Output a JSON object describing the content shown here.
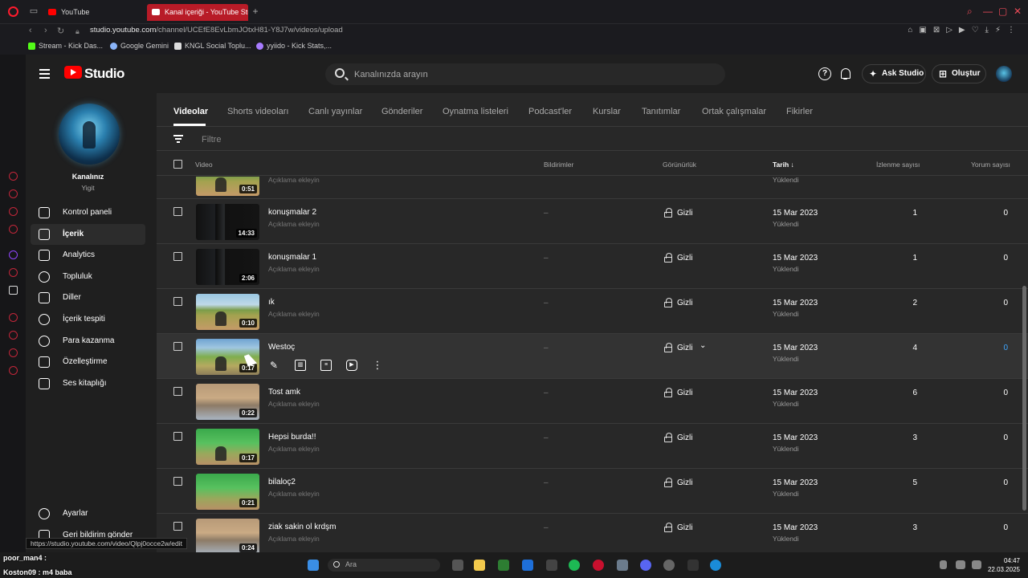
{
  "browser": {
    "tabs": [
      {
        "label": "YouTube",
        "active": false
      },
      {
        "label": "Kanal içeriği - YouTube Stu",
        "active": true
      }
    ],
    "url_host": "studio.youtube.com",
    "url_path": "/channel/UCEfE8EvLbmJOtxH81-Y8J7w/videos/upload",
    "bookmarks": [
      "Stream - Kick Das...",
      "Google Gemini",
      "KNGL Social Toplu...",
      "yyiido - Kick Stats,..."
    ]
  },
  "header": {
    "logo_text": "Studio",
    "search_placeholder": "Kanalınızda arayın",
    "ask_studio": "Ask Studio",
    "create": "Oluştur"
  },
  "channel": {
    "title": "Kanalınız",
    "name": "Yigit"
  },
  "nav": [
    {
      "label": "Kontrol paneli",
      "icon": "dashboard-icon"
    },
    {
      "label": "İçerik",
      "icon": "content-icon",
      "active": true
    },
    {
      "label": "Analytics",
      "icon": "analytics-icon"
    },
    {
      "label": "Topluluk",
      "icon": "community-icon"
    },
    {
      "label": "Diller",
      "icon": "subtitles-icon"
    },
    {
      "label": "İçerik tespiti",
      "icon": "copyright-icon"
    },
    {
      "label": "Para kazanma",
      "icon": "monetization-icon"
    },
    {
      "label": "Özelleştirme",
      "icon": "customization-icon"
    },
    {
      "label": "Ses kitaplığı",
      "icon": "audio-library-icon"
    }
  ],
  "nav_bottom": {
    "settings": "Ayarlar",
    "feedback": "Geri bildirim gönder"
  },
  "content_tabs": [
    "Videolar",
    "Shorts videoları",
    "Canlı yayınlar",
    "Gönderiler",
    "Oynatma listeleri",
    "Podcast'ler",
    "Kurslar",
    "Tanıtımlar",
    "Ortak çalışmalar",
    "Fikirler"
  ],
  "filter_placeholder": "Filtre",
  "columns": {
    "video": "Video",
    "notifications": "Bildirimler",
    "visibility": "Görünürlük",
    "date": "Tarih",
    "views": "İzlenme sayısı",
    "comments": "Yorum sayısı"
  },
  "desc_placeholder": "Açıklama ekleyin",
  "partial_row": {
    "duration": "0:51"
  },
  "rows": [
    {
      "title": "konuşmalar 2",
      "duration": "14:33",
      "notifications": "–",
      "visibility": "Gizli",
      "date": "15 Mar 2023",
      "status": "Yüklendi",
      "views": "1",
      "comments": "0"
    },
    {
      "title": "konuşmalar 1",
      "duration": "2:06",
      "notifications": "–",
      "visibility": "Gizli",
      "date": "15 Mar 2023",
      "status": "Yüklendi",
      "views": "1",
      "comments": "0"
    },
    {
      "title": "ık",
      "duration": "0:10",
      "notifications": "–",
      "visibility": "Gizli",
      "date": "15 Mar 2023",
      "status": "Yüklendi",
      "views": "2",
      "comments": "0"
    },
    {
      "title": "Westoç",
      "duration": "0:17",
      "notifications": "–",
      "visibility": "Gizli",
      "date": "15 Mar 2023",
      "status": "Yüklendi",
      "views": "4",
      "comments": "0",
      "hover": true
    },
    {
      "title": "Tost amk",
      "duration": "0:22",
      "notifications": "–",
      "visibility": "Gizli",
      "date": "15 Mar 2023",
      "status": "Yüklendi",
      "views": "6",
      "comments": "0"
    },
    {
      "title": "Hepsi burda!!",
      "duration": "0:17",
      "notifications": "–",
      "visibility": "Gizli",
      "date": "15 Mar 2023",
      "status": "Yüklendi",
      "views": "3",
      "comments": "0"
    },
    {
      "title": "bilaloç2",
      "duration": "0:21",
      "notifications": "–",
      "visibility": "Gizli",
      "date": "15 Mar 2023",
      "status": "Yüklendi",
      "views": "5",
      "comments": "0"
    },
    {
      "title": "ziak sakin ol krdşm",
      "duration": "0:24",
      "notifications": "–",
      "visibility": "Gizli",
      "date": "15 Mar 2023",
      "status": "Yüklendi",
      "views": "3",
      "comments": "0"
    }
  ],
  "status_bar_url": "https://studio.youtube.com/video/Qlpj0occe2w/edit",
  "overlay_chat": [
    {
      "user": "poor_man4 :",
      "text": ""
    },
    {
      "user": "Koston09 :",
      "text": "m4 baba"
    }
  ],
  "taskbar": {
    "search_placeholder": "Ara",
    "time": "04:47",
    "date": "22.03.2025"
  },
  "colors": {
    "accent_red": "#ff0000",
    "link_blue": "#3ea6ff",
    "opera_tab": "#b81b27"
  }
}
